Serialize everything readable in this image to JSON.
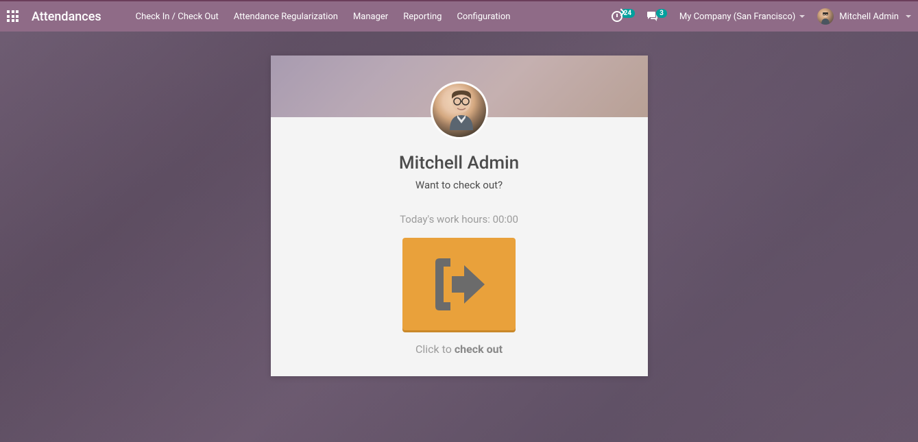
{
  "navbar": {
    "app_title": "Attendances",
    "links": {
      "checkin": "Check In / Check Out",
      "regularization": "Attendance Regularization",
      "manager": "Manager",
      "reporting": "Reporting",
      "configuration": "Configuration"
    },
    "activity_count": "24",
    "messages_count": "3",
    "company": "My Company (San Francisco)",
    "username": "Mitchell Admin"
  },
  "card": {
    "employee_name": "Mitchell Admin",
    "prompt": "Want to check out?",
    "work_hours_label": "Today's work hours: ",
    "work_hours_value": "00:00",
    "click_hint_prefix": "Click to ",
    "click_hint_action": "check out"
  }
}
